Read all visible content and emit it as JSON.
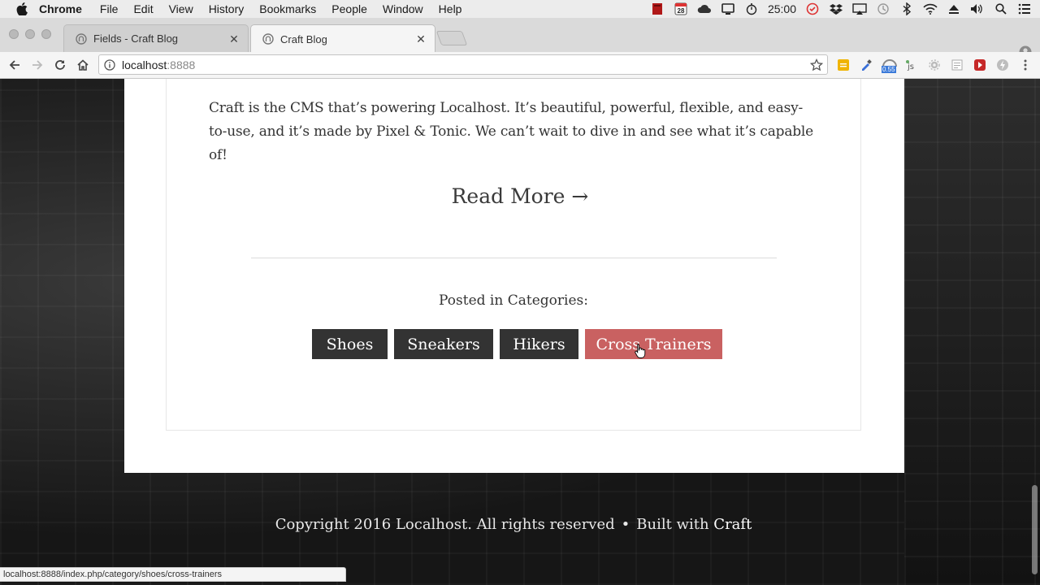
{
  "menubar": {
    "app": "Chrome",
    "items": [
      "File",
      "Edit",
      "View",
      "History",
      "Bookmarks",
      "People",
      "Window",
      "Help"
    ],
    "calendar_day": "28",
    "clock": "25:00"
  },
  "tabs": [
    {
      "title": "Fields - Craft Blog",
      "active": false
    },
    {
      "title": "Craft Blog",
      "active": true
    }
  ],
  "toolbar": {
    "url_host": "localhost",
    "url_port": ":8888",
    "extension_badge": "0.55"
  },
  "post": {
    "excerpt": "Craft is the CMS that’s powering Localhost. It’s beautiful, powerful, flexible, and easy-to-use, and it’s made by Pixel & Tonic. We can’t wait to dive in and see what it’s capable of!",
    "read_more": "Read More →",
    "categories_label": "Posted in Categories:",
    "categories": [
      "Shoes",
      "Sneakers",
      "Hikers",
      "Cross Trainers"
    ]
  },
  "footer": {
    "copyright": "Copyright 2016 Localhost. All rights reserved",
    "separator": "•",
    "built_with": "Built with",
    "brand": "Craft"
  },
  "status_bar": {
    "url": "localhost:8888/index.php/category/shoes/cross-trainers"
  },
  "colors": {
    "category_button": "#333333",
    "category_button_hover": "#c96161",
    "page_background": "#151515"
  }
}
